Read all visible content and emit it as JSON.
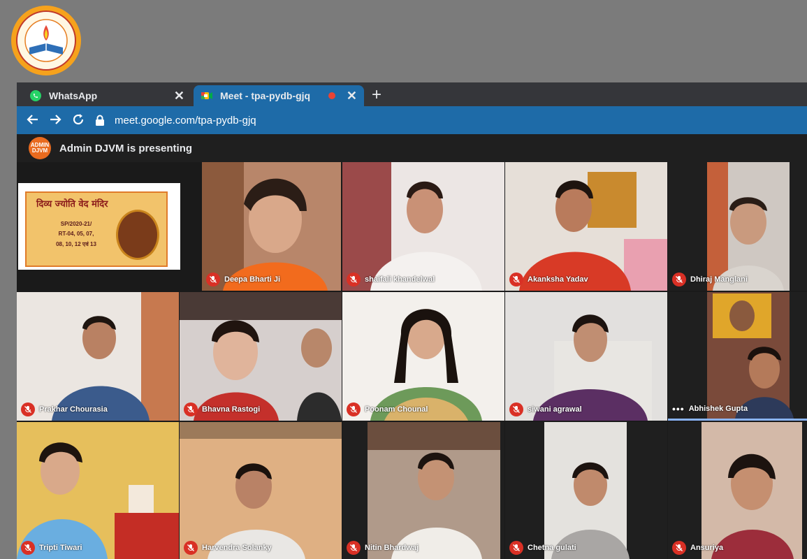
{
  "browser": {
    "tabs": [
      {
        "title": "WhatsApp",
        "icon": "whatsapp-icon",
        "active": false
      },
      {
        "title": "Meet - tpa-pydb-gjq",
        "icon": "meet-icon",
        "active": true
      }
    ],
    "url": "meet.google.com/tpa-pydb-gjq"
  },
  "meet": {
    "presenter_avatar": "ADMIN DJVM",
    "presenting_text": "Admin DJVM is presenting",
    "slide": {
      "title": "दिव्य ज्योति वेद मंदिर",
      "line1": "SP/2020-21/",
      "line2": "RT-04, 05, 07,",
      "line3": "08, 10, 12 एवं 13"
    },
    "participants": [
      {
        "name": "Deepa Bharti Ji",
        "muted": true
      },
      {
        "name": "shaifali khandelwal",
        "muted": true
      },
      {
        "name": "Akanksha Yadav",
        "muted": true
      },
      {
        "name": "Dhiraj Manglani",
        "muted": true
      },
      {
        "name": "Prakhar Chourasia",
        "muted": true
      },
      {
        "name": "Bhavna Rastogi",
        "muted": true
      },
      {
        "name": "Poonam Chounal",
        "muted": true
      },
      {
        "name": "siwani agrawal",
        "muted": true
      },
      {
        "name": "Abhishek Gupta",
        "muted": false
      },
      {
        "name": "Tripti Tiwari",
        "muted": true
      },
      {
        "name": "Harvendra Solanky",
        "muted": true
      },
      {
        "name": "Nitin Bhardwaj",
        "muted": true
      },
      {
        "name": "Chetna gulati",
        "muted": true
      },
      {
        "name": "Ansuriya",
        "muted": true
      }
    ]
  },
  "colors": {
    "tab_active": "#1e6ba8",
    "mute_red": "#d93025",
    "avatar_orange": "#e96b1f",
    "speaking_blue": "#8ab4f8"
  }
}
